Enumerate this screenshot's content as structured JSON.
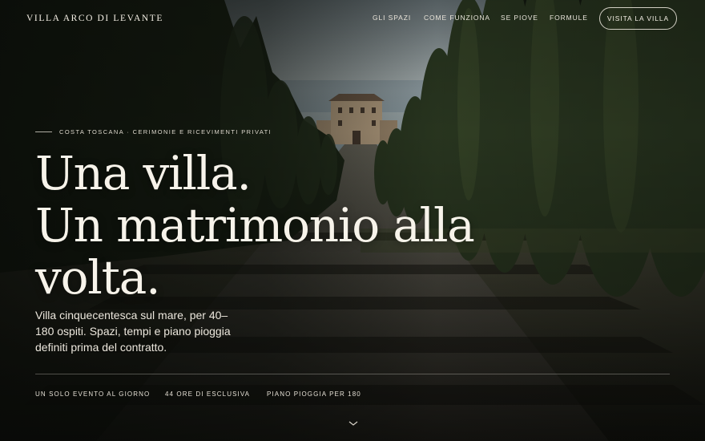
{
  "header": {
    "logo": "VILLA ARCO DI LEVANTE",
    "nav": [
      {
        "label": "GLI SPAZI"
      },
      {
        "label": "COME FUNZIONA"
      },
      {
        "label": "SE PIOVE"
      },
      {
        "label": "FORMULE"
      }
    ],
    "cta_label": "VISITA LA VILLA"
  },
  "hero": {
    "eyebrow": "COSTA TOSCANA · CERIMONIE E RICEVIMENTI PRIVATI",
    "headline_lines": [
      "Una villa.",
      "Un matrimonio alla",
      "volta."
    ],
    "lede": "Villa cinquecentesca sul mare, per 40–180 ospiti. Spazi, tempi e piano pioggia definiti prima del contratto.",
    "stats": [
      {
        "label": "UN SOLO EVENTO AL GIORNO"
      },
      {
        "label": "44 ORE DI ESCLUSIVA"
      },
      {
        "label": "PIANO PIOGGIA PER 180"
      }
    ],
    "scroll_icon": "chevron-down-icon"
  },
  "colors": {
    "background": "#0f120c",
    "text": "#f3eee4",
    "cypress": "#26331d",
    "sky": "#b7c2c4"
  }
}
